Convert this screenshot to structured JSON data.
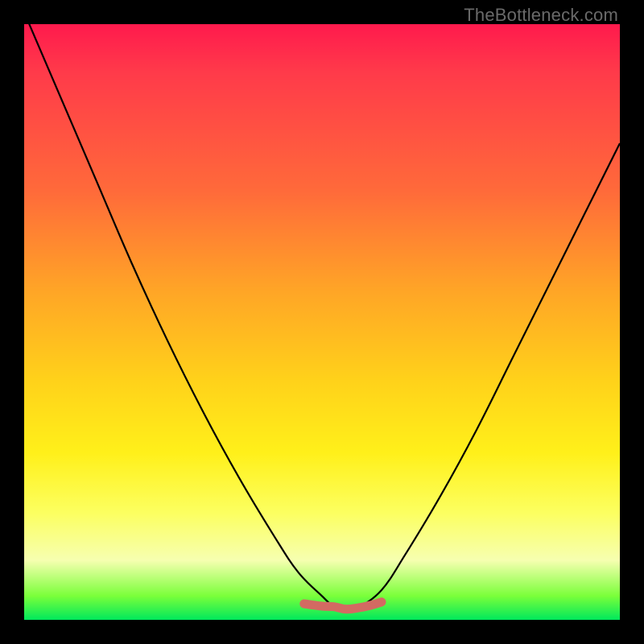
{
  "watermark": {
    "text": "TheBottleneck.com"
  },
  "chart_data": {
    "type": "line",
    "title": "",
    "xlabel": "",
    "ylabel": "",
    "xlim": [
      0,
      100
    ],
    "ylim": [
      0,
      100
    ],
    "grid": false,
    "series": [
      {
        "name": "main-curve",
        "color": "#000000",
        "x": [
          0,
          6,
          12,
          18,
          24,
          30,
          36,
          42,
          46,
          50,
          52,
          54,
          56,
          60,
          64,
          70,
          76,
          82,
          88,
          94,
          100
        ],
        "values": [
          102,
          88,
          74,
          60,
          47,
          35,
          24,
          14,
          8,
          4,
          2.2,
          1.6,
          2.0,
          5,
          11,
          21,
          32,
          44,
          56,
          68,
          80
        ]
      },
      {
        "name": "highlight-band",
        "color": "#d36a62",
        "x": [
          47,
          50,
          52,
          54,
          56,
          58,
          60
        ],
        "values": [
          2.7,
          2.3,
          2.2,
          1.8,
          2.0,
          2.4,
          3.0
        ]
      }
    ],
    "annotations": []
  },
  "colors": {
    "gradient_top": "#ff1a4d",
    "gradient_mid1": "#ffa626",
    "gradient_mid2": "#fff01a",
    "gradient_bottom": "#00e85c",
    "curve": "#000000",
    "highlight": "#d36a62",
    "frame": "#000000"
  }
}
